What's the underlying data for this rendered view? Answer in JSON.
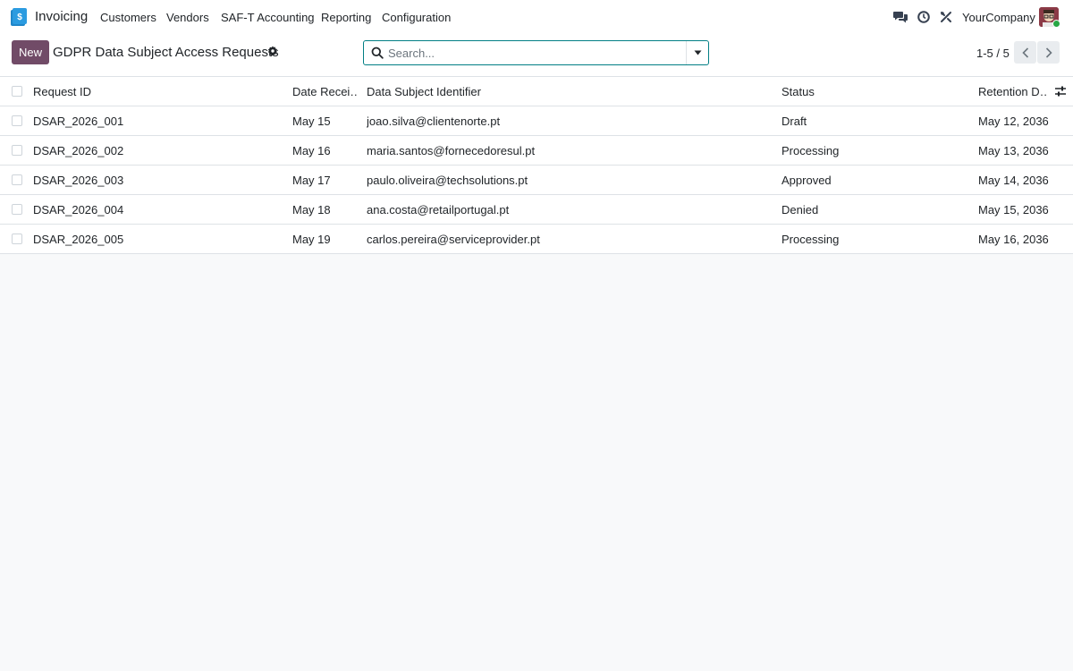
{
  "nav": {
    "app_name": "Invoicing",
    "items": [
      "Customers",
      "Vendors",
      "SAF-T Accounting",
      "Reporting",
      "Configuration"
    ],
    "company": "YourCompany"
  },
  "control": {
    "new_label": "New",
    "title": "GDPR Data Subject Access Requests",
    "search_placeholder": "Search...",
    "pager": "1-5 / 5"
  },
  "table": {
    "columns": [
      "Request ID",
      "Date Recei…",
      "Data Subject Identifier",
      "Status",
      "Retention D…"
    ],
    "rows": [
      [
        "DSAR_2026_001",
        "May 15",
        "joao.silva@clientenorte.pt",
        "Draft",
        "May 12, 2036"
      ],
      [
        "DSAR_2026_002",
        "May 16",
        "maria.santos@fornecedoresul.pt",
        "Processing",
        "May 13, 2036"
      ],
      [
        "DSAR_2026_003",
        "May 17",
        "paulo.oliveira@techsolutions.pt",
        "Approved",
        "May 14, 2036"
      ],
      [
        "DSAR_2026_004",
        "May 18",
        "ana.costa@retailportugal.pt",
        "Denied",
        "May 15, 2036"
      ],
      [
        "DSAR_2026_005",
        "May 19",
        "carlos.pereira@serviceprovider.pt",
        "Processing",
        "May 16, 2036"
      ]
    ]
  },
  "colors": {
    "brand": "#714b67",
    "accent": "#017e84",
    "online": "#28a745"
  },
  "icons": [
    "app-icon",
    "chat-icon",
    "clock-icon",
    "tools-icon",
    "gear-icon",
    "search-icon",
    "caret-down-icon",
    "chevron-left-icon",
    "chevron-right-icon",
    "column-settings-icon"
  ]
}
